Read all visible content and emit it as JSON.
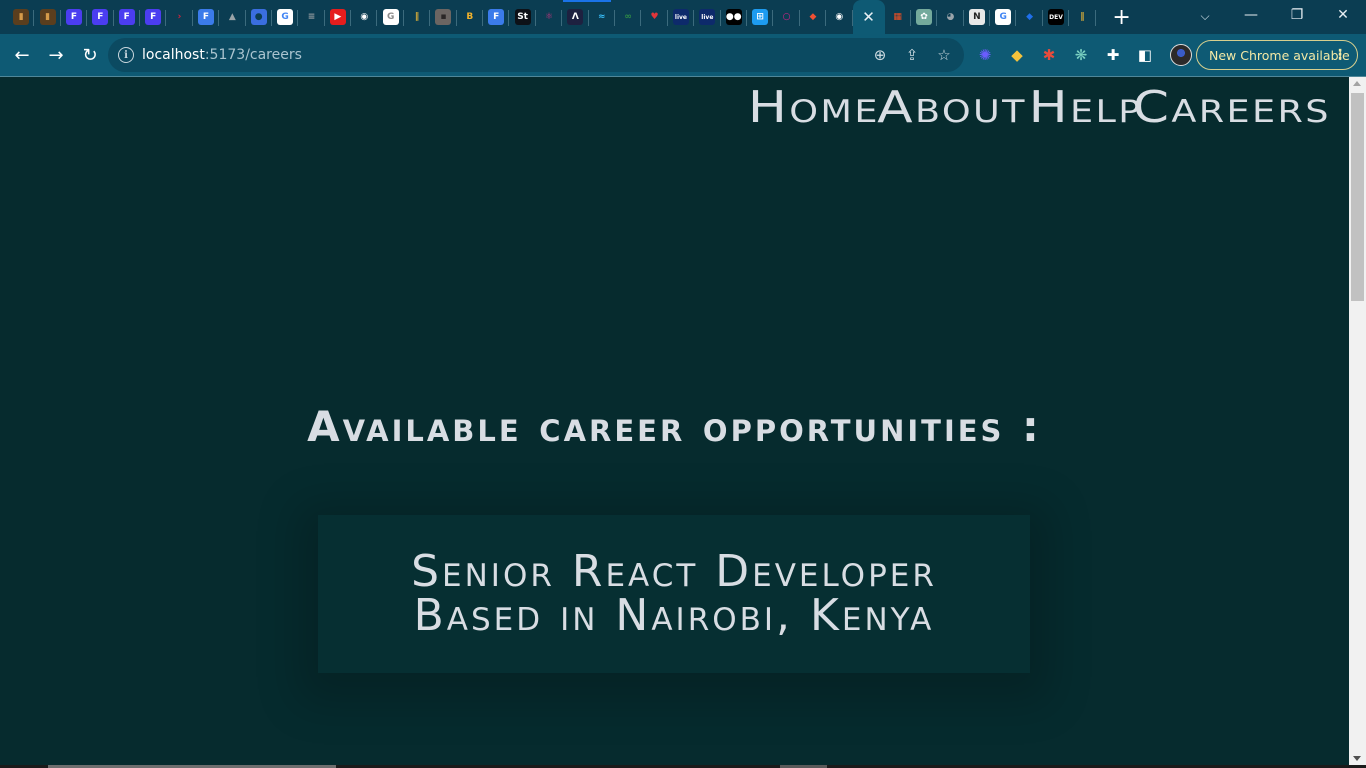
{
  "browser": {
    "tabs": [
      {
        "icon": "wood-icon",
        "glyph": "▮",
        "bg": "#5a3e1e",
        "fg": "#d59b4a"
      },
      {
        "icon": "wood-icon",
        "glyph": "▮",
        "bg": "#5a3e1e",
        "fg": "#d59b4a"
      },
      {
        "icon": "framer-icon",
        "glyph": "F",
        "bg": "#4b3df0",
        "fg": "#ffffff"
      },
      {
        "icon": "framer-icon",
        "glyph": "F",
        "bg": "#4b3df0",
        "fg": "#ffffff"
      },
      {
        "icon": "framer-icon",
        "glyph": "F",
        "bg": "#4b3df0",
        "fg": "#ffffff"
      },
      {
        "icon": "framer-icon",
        "glyph": "F",
        "bg": "#4b3df0",
        "fg": "#ffffff"
      },
      {
        "icon": "arrow-logo-icon",
        "glyph": "›",
        "bg": "transparent",
        "fg": "#e0223c"
      },
      {
        "icon": "f-logo-icon",
        "glyph": "F",
        "bg": "#3b7bea",
        "fg": "#ffffff"
      },
      {
        "icon": "firebase-icon",
        "glyph": "▲",
        "bg": "transparent",
        "fg": "#9aa4a8"
      },
      {
        "icon": "shield-icon",
        "glyph": "●",
        "bg": "#3a6ee0",
        "fg": "#0b3d52"
      },
      {
        "icon": "google-icon",
        "glyph": "G",
        "bg": "#ffffff",
        "fg": "#4285f4"
      },
      {
        "icon": "stripe-logo-icon",
        "glyph": "≡",
        "bg": "transparent",
        "fg": "#9aa0a3"
      },
      {
        "icon": "youtube-icon",
        "glyph": "▶",
        "bg": "#e51d1d",
        "fg": "#ffffff"
      },
      {
        "icon": "github-icon",
        "glyph": "◉",
        "bg": "transparent",
        "fg": "#ffffff"
      },
      {
        "icon": "google-icon",
        "glyph": "G",
        "bg": "#ffffff",
        "fg": "#8c8c8c"
      },
      {
        "icon": "bars-icon",
        "glyph": "‖",
        "bg": "transparent",
        "fg": "#c9a43a"
      },
      {
        "icon": "portrait-icon",
        "glyph": "▪",
        "bg": "#6b6562",
        "fg": "#2a2626"
      },
      {
        "icon": "colorful-logo-icon",
        "glyph": "B",
        "bg": "transparent",
        "fg": "#f0b12c"
      },
      {
        "icon": "f-logo-icon",
        "glyph": "F",
        "bg": "#3b7bea",
        "fg": "#ffffff"
      },
      {
        "icon": "st-icon",
        "glyph": "St",
        "bg": "#0d1117",
        "fg": "#ffffff"
      },
      {
        "icon": "react-icon",
        "glyph": "⚛",
        "bg": "transparent",
        "fg": "#c2367f"
      },
      {
        "icon": "lambda-icon",
        "glyph": "Λ",
        "bg": "#1e2140",
        "fg": "#ffffff"
      },
      {
        "icon": "tailwind-icon",
        "glyph": "≈",
        "bg": "transparent",
        "fg": "#38bdf8"
      },
      {
        "icon": "geeks-icon",
        "glyph": "∞",
        "bg": "transparent",
        "fg": "#2f8d46"
      },
      {
        "icon": "devil-icon",
        "glyph": "♥",
        "bg": "transparent",
        "fg": "#e0353a"
      },
      {
        "icon": "live-icon",
        "glyph": "live",
        "bg": "#0d2a6b",
        "fg": "#ffffff"
      },
      {
        "icon": "live-icon",
        "glyph": "live",
        "bg": "#0d2a6b",
        "fg": "#ffffff"
      },
      {
        "icon": "medium-icon",
        "glyph": "●●",
        "bg": "#000000",
        "fg": "#ffffff"
      },
      {
        "icon": "windows-icon",
        "glyph": "⊞",
        "bg": "#1d9bf0",
        "fg": "#ffffff"
      },
      {
        "icon": "ring-icon",
        "glyph": "○",
        "bg": "transparent",
        "fg": "#e0218a"
      },
      {
        "icon": "git-icon",
        "glyph": "◆",
        "bg": "transparent",
        "fg": "#f05033"
      },
      {
        "icon": "github-icon",
        "glyph": "◉",
        "bg": "transparent",
        "fg": "#ffffff"
      }
    ],
    "active_tab": {
      "close_glyph": "✕"
    },
    "tabs_after": [
      {
        "icon": "microsoft-icon",
        "glyph": "▦",
        "bg": "transparent",
        "fg": "#f25022"
      },
      {
        "icon": "chatgpt-icon",
        "glyph": "✿",
        "bg": "#74aa9c",
        "fg": "#ffffff"
      },
      {
        "icon": "globe-icon",
        "glyph": "◕",
        "bg": "transparent",
        "fg": "#9aa4aa"
      },
      {
        "icon": "notion-icon",
        "glyph": "N",
        "bg": "#e8e8e8",
        "fg": "#222222"
      },
      {
        "icon": "google-icon",
        "glyph": "G",
        "bg": "#ffffff",
        "fg": "#4285f4"
      },
      {
        "icon": "diamond-icon",
        "glyph": "◆",
        "bg": "transparent",
        "fg": "#1f6feb"
      },
      {
        "icon": "dev-icon",
        "glyph": "DEV",
        "bg": "#000000",
        "fg": "#ffffff"
      },
      {
        "icon": "bars-icon",
        "glyph": "‖",
        "bg": "transparent",
        "fg": "#c9a43a"
      }
    ],
    "new_tab_glyph": "+",
    "tab_search_glyph": "⌵",
    "window": {
      "minimize": "—",
      "restore": "❐",
      "close": "✕"
    },
    "nav": {
      "back": "←",
      "forward": "→",
      "reload": "↻"
    },
    "url": {
      "host": "localhost",
      "path": ":5173/careers"
    },
    "omnibox_icons": {
      "zoom": "⊕",
      "share": "⇪",
      "bookmark": "☆"
    },
    "extensions": [
      {
        "icon": "sparkle-extension-icon",
        "glyph": "✺",
        "fg": "#6b5cff"
      },
      {
        "icon": "diamond-extension-icon",
        "glyph": "◆",
        "fg": "#f6c33c"
      },
      {
        "icon": "bug-extension-icon",
        "glyph": "✱",
        "fg": "#e74c3c"
      },
      {
        "icon": "atom-extension-icon",
        "glyph": "❋",
        "fg": "#7ad1c2"
      },
      {
        "icon": "puzzle-icon",
        "glyph": "✚",
        "fg": "#ffffff"
      },
      {
        "icon": "side-panel-icon",
        "glyph": "◧",
        "fg": "#ffffff"
      }
    ],
    "update_button": {
      "label": "New Chrome available",
      "menu_glyph": "⋮"
    }
  },
  "page": {
    "nav": [
      {
        "label": "Home"
      },
      {
        "label": "About"
      },
      {
        "label": "Help"
      },
      {
        "label": "Careers"
      }
    ],
    "heading": "Available career opportunities :",
    "jobs": [
      {
        "title": "Senior React Developer",
        "location": "Based in Nairobi, Kenya"
      }
    ]
  }
}
